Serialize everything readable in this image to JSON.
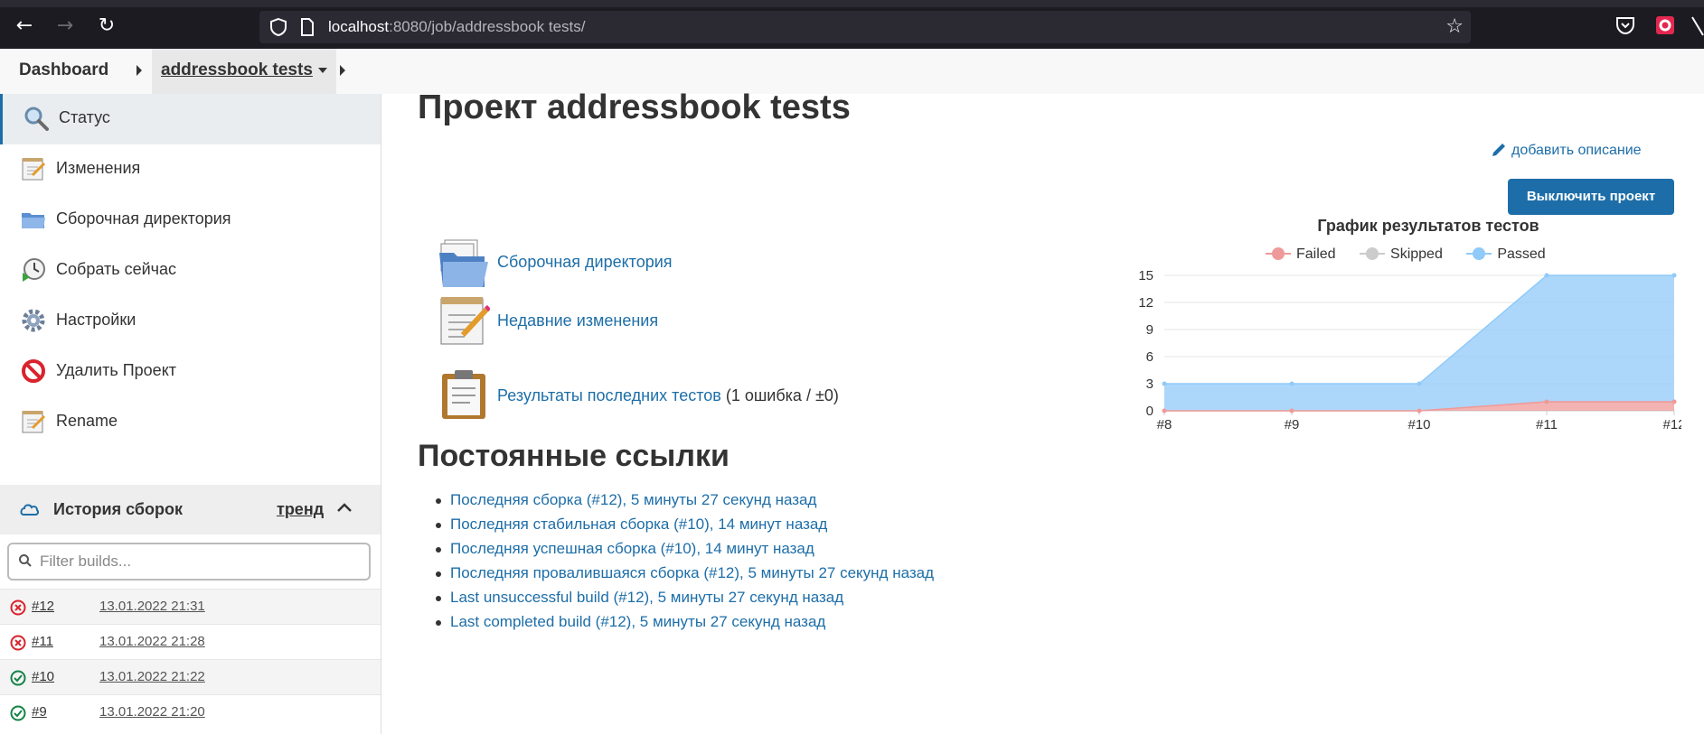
{
  "browser": {
    "url_host": "localhost",
    "url_rest": ":8080/job/addressbook tests/"
  },
  "breadcrumb": {
    "dashboard": "Dashboard",
    "current": "addressbook tests"
  },
  "sidebar": {
    "items": [
      {
        "label": "Статус",
        "icon": "magnifier-icon"
      },
      {
        "label": "Изменения",
        "icon": "notepad-icon"
      },
      {
        "label": "Сборочная директория",
        "icon": "folder-icon"
      },
      {
        "label": "Собрать сейчас",
        "icon": "clock-play-icon"
      },
      {
        "label": "Настройки",
        "icon": "gear-icon"
      },
      {
        "label": "Удалить Проект",
        "icon": "no-entry-icon"
      },
      {
        "label": "Rename",
        "icon": "notepad-icon"
      }
    ],
    "history": {
      "title": "История сборок",
      "trend": "тренд",
      "filter_placeholder": "Filter builds...",
      "builds": [
        {
          "num": "#12",
          "date": "13.01.2022 21:31",
          "status": "failed"
        },
        {
          "num": "#11",
          "date": "13.01.2022 21:28",
          "status": "failed"
        },
        {
          "num": "#10",
          "date": "13.01.2022 21:22",
          "status": "success"
        },
        {
          "num": "#9",
          "date": "13.01.2022 21:20",
          "status": "success"
        }
      ]
    }
  },
  "main": {
    "title": "Проект addressbook tests",
    "add_description": "добавить описание",
    "disable_button": "Выключить проект",
    "links": {
      "workspace": "Сборочная директория",
      "changes": "Недавние изменения",
      "test_results": "Результаты последних тестов",
      "test_results_extra": " (1 ошибка / ±0)"
    },
    "permalinks_title": "Постоянные ссылки",
    "permalinks": [
      "Последняя сборка (#12), 5 минуты 27 секунд назад",
      "Последняя стабильная сборка (#10), 14 минут назад",
      "Последняя успешная сборка (#10), 14 минут назад",
      "Последняя провалившаяся сборка (#12), 5 минуты 27 секунд назад",
      "Last unsuccessful build (#12), 5 минуты 27 секунд назад",
      "Last completed build (#12), 5 минуты 27 секунд назад"
    ]
  },
  "colors": {
    "link": "#1d6ea8",
    "failed": "#ef9a9a",
    "skipped": "#cccccc",
    "passed": "#90caf9"
  },
  "chart_data": {
    "type": "area",
    "title": "График результатов тестов",
    "categories": [
      "#8",
      "#9",
      "#10",
      "#11",
      "#12"
    ],
    "ylim": [
      0,
      15
    ],
    "yticks": [
      "0",
      "3",
      "6",
      "9",
      "12",
      "15"
    ],
    "stacked": true,
    "series": [
      {
        "name": "Failed",
        "values": [
          0,
          0,
          0,
          1,
          1
        ],
        "color": "#ef9a9a"
      },
      {
        "name": "Skipped",
        "values": [
          0,
          0,
          0,
          0,
          0
        ],
        "color": "#cccccc"
      },
      {
        "name": "Passed",
        "values": [
          3,
          3,
          3,
          14,
          14
        ],
        "color": "#90caf9"
      }
    ],
    "legend_position": "top",
    "grid": true
  }
}
